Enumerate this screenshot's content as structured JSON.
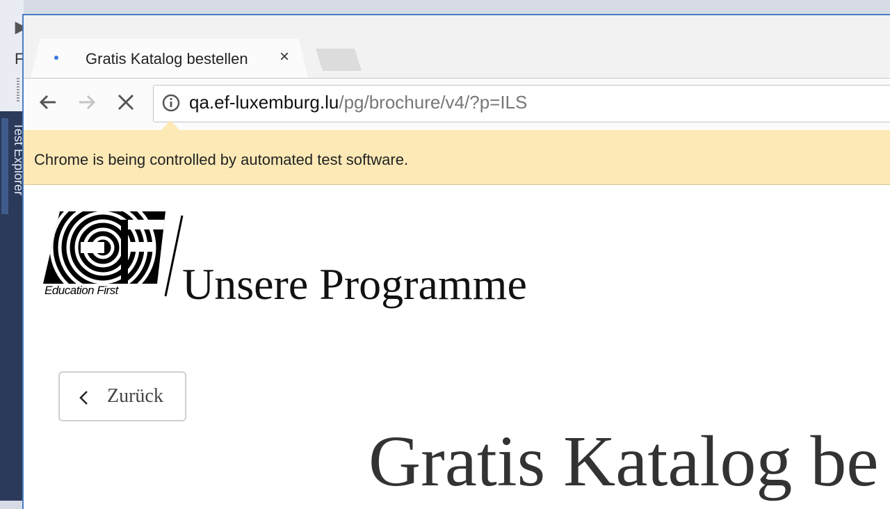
{
  "ide": {
    "vertical_tab": "Test Explorer",
    "menu_letter": "F"
  },
  "browser": {
    "tab": {
      "title": "Gratis Katalog bestellen",
      "close_glyph": "×"
    },
    "address": {
      "host": "qa.ef-luxemburg.lu",
      "path": "/pg/brochure/v4/?p=ILS"
    },
    "infobar": {
      "text": "Chrome is being controlled by automated test software."
    }
  },
  "page": {
    "logo_caption": "Education First",
    "brand_title": "Unsere Programme",
    "back_button_label": "Zurück",
    "heading": "Gratis Katalog be"
  },
  "colors": {
    "infobar": "#fde9b6",
    "accent_blue": "#3b7ae0",
    "ide_dark": "#2b3a5a"
  }
}
